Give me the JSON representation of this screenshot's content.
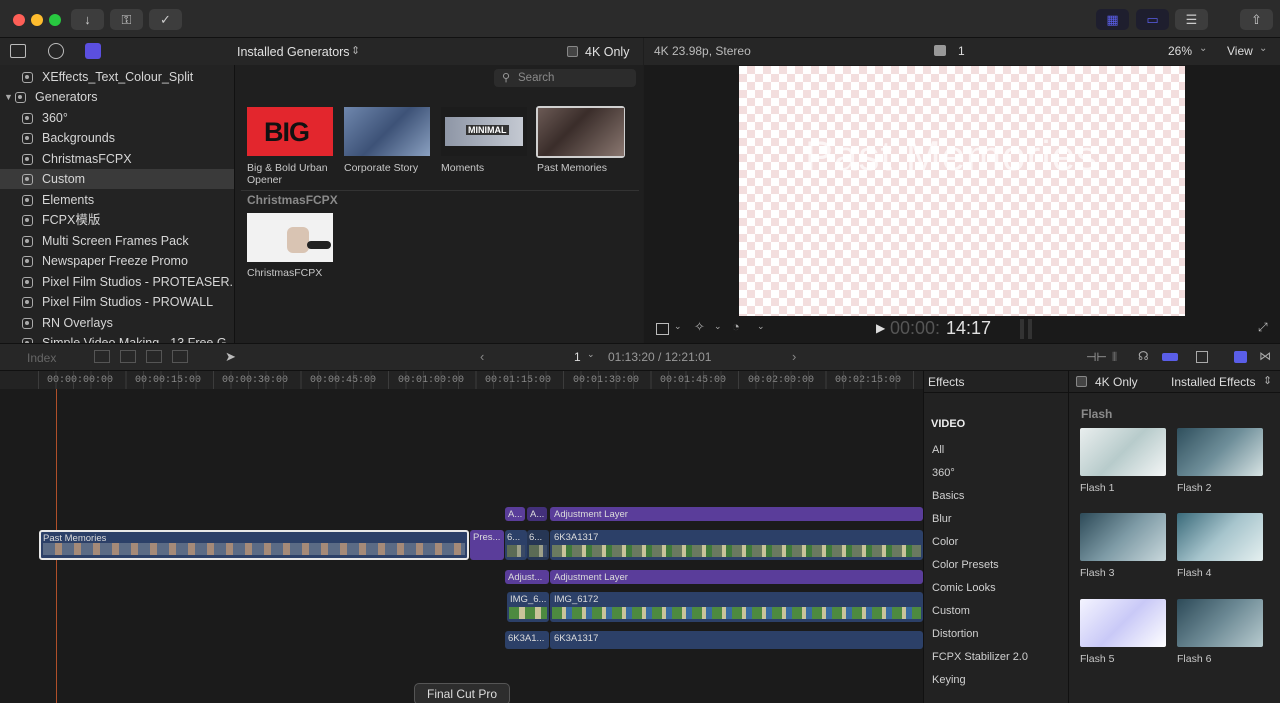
{
  "toolbar": {
    "icons": [
      "import-icon",
      "keywords-icon",
      "background-tasks-icon",
      "layout-grid-icon",
      "layout-timeline-icon",
      "inspector-toggle-icon",
      "share-icon"
    ]
  },
  "library": {
    "tabs": [
      "photos-icon",
      "music-icon",
      "titles-generators-icon"
    ]
  },
  "browser": {
    "title": "Installed Generators",
    "filter_label": "4K Only",
    "search_placeholder": "Search",
    "items": [
      {
        "label": "Big & Bold Urban Opener"
      },
      {
        "label": "Corporate Story"
      },
      {
        "label": "Moments"
      },
      {
        "label": "Past Memories"
      }
    ],
    "section2": "ChristmasFCPX",
    "items2": [
      {
        "label": "ChristmasFCPX"
      }
    ],
    "big_text": "BIG",
    "minimal_text": "MINIMAL"
  },
  "sidebar": {
    "items": [
      {
        "label": "XEffects_Text_Colour_Split"
      },
      {
        "label": "Generators"
      },
      {
        "label": "360°"
      },
      {
        "label": "Backgrounds"
      },
      {
        "label": "ChristmasFCPX"
      },
      {
        "label": "Custom"
      },
      {
        "label": "Elements"
      },
      {
        "label": "FCPX模版"
      },
      {
        "label": "Multi Screen Frames Pack"
      },
      {
        "label": "Newspaper Freeze Promo"
      },
      {
        "label": "Pixel Film Studios - PROTEASER..."
      },
      {
        "label": "Pixel Film Studios - PROWALL"
      },
      {
        "label": "RN Overlays"
      },
      {
        "label": "Simple Video Making - 13 Free G..."
      }
    ]
  },
  "viewer": {
    "format": "4K 23.98p, Stereo",
    "clip_count": "1",
    "zoom": "26%",
    "view_label": "View",
    "timecode_dim": "00:00:",
    "timecode": "14:17",
    "canvas_title": "Past Memories"
  },
  "timeline": {
    "index_label": "Index",
    "page": "1",
    "position": "01:13:20 / 12:21:01",
    "ruler": [
      "00:00:00:00",
      "00:00:15:00",
      "00:00:30:00",
      "00:00:45:00",
      "00:01:00:00",
      "00:01:15:00",
      "00:01:30:00",
      "00:01:45:00",
      "00:02:00:00",
      "00:02:15:00"
    ],
    "clips": {
      "past_memories": "Past Memories",
      "pres": "Pres...",
      "adj_a1": "A...",
      "adj_a2": "A...",
      "adj_layer1": "Adjustment Layer",
      "c6a": "6...",
      "c6b": "6...",
      "k1317": "6K3A1317",
      "adjust_short": "Adjust...",
      "adj_layer2": "Adjustment Layer",
      "img6": "IMG_6...",
      "img6172": "IMG_6172",
      "k3a1": "6K3A1...",
      "k1317b": "6K3A1317"
    },
    "tooltip": "Final Cut Pro"
  },
  "effects": {
    "title": "Effects",
    "filter_label": "4K Only",
    "installed": "Installed Effects",
    "section": "Flash",
    "video_header": "VIDEO",
    "categories": [
      "All",
      "360°",
      "Basics",
      "Blur",
      "Color",
      "Color Presets",
      "Comic Looks",
      "Custom",
      "Distortion",
      "FCPX Stabilizer 2.0",
      "Keying"
    ],
    "items": [
      {
        "label": "Flash 1"
      },
      {
        "label": "Flash 2"
      },
      {
        "label": "Flash 3"
      },
      {
        "label": "Flash 4"
      },
      {
        "label": "Flash 5"
      },
      {
        "label": "Flash 6"
      }
    ]
  }
}
